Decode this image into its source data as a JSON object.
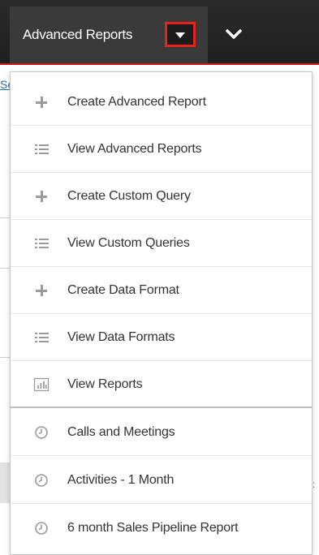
{
  "topbar": {
    "module_label": "Advanced Reports",
    "caret_icon": "caret-down-icon",
    "more_icon": "chevron-down-icon",
    "accent_color": "#e8231a"
  },
  "menu": {
    "items": [
      {
        "label": "Create Advanced Report",
        "icon": "plus-icon"
      },
      {
        "label": "View Advanced Reports",
        "icon": "list-icon"
      },
      {
        "label": "Create Custom Query",
        "icon": "plus-icon"
      },
      {
        "label": "View Custom Queries",
        "icon": "list-icon"
      },
      {
        "label": "Create Data Format",
        "icon": "plus-icon"
      },
      {
        "label": "View Data Formats",
        "icon": "list-icon"
      },
      {
        "label": "View Reports",
        "icon": "bar-chart-icon"
      },
      {
        "label": "Calls and Meetings",
        "icon": "clock-icon"
      },
      {
        "label": "Activities - 1 Month",
        "icon": "clock-icon"
      },
      {
        "label": "6 month Sales Pipeline Report",
        "icon": "clock-icon"
      }
    ]
  }
}
